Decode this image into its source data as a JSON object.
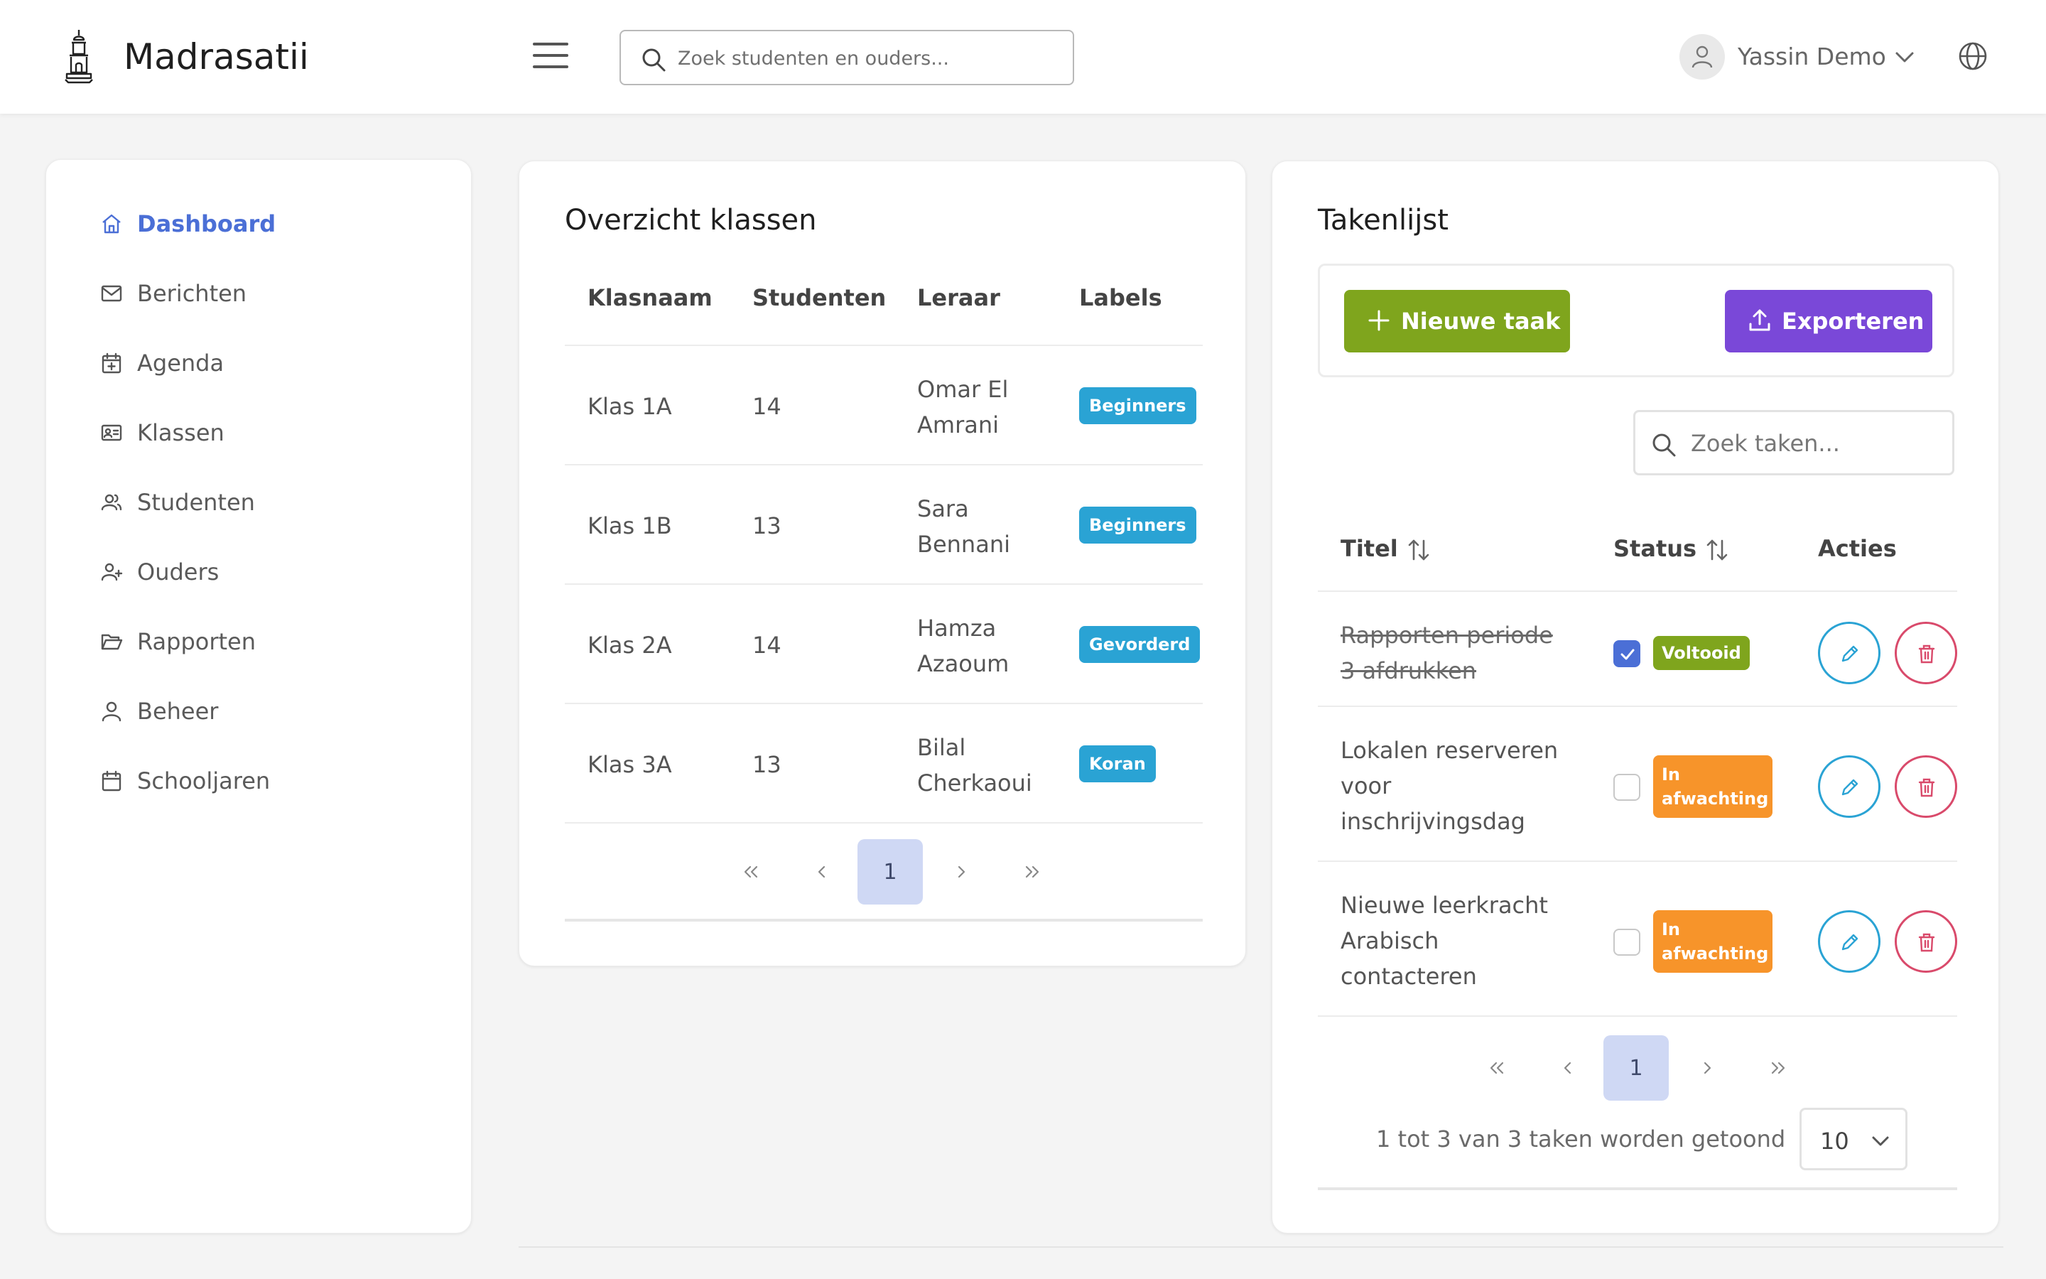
{
  "app": {
    "title": "Madrasatii"
  },
  "header": {
    "search_placeholder": "Zoek studenten en ouders...",
    "user_name": "Yassin Demo"
  },
  "sidebar": {
    "items": [
      {
        "label": "Dashboard",
        "icon": "home-icon",
        "active": true
      },
      {
        "label": "Berichten",
        "icon": "mail-icon"
      },
      {
        "label": "Agenda",
        "icon": "calendar-plus-icon"
      },
      {
        "label": "Klassen",
        "icon": "id-card-icon"
      },
      {
        "label": "Studenten",
        "icon": "users-icon"
      },
      {
        "label": "Ouders",
        "icon": "user-plus-icon"
      },
      {
        "label": "Rapporten",
        "icon": "folder-open-icon"
      },
      {
        "label": "Beheer",
        "icon": "user-icon"
      },
      {
        "label": "Schooljaren",
        "icon": "calendar-icon"
      }
    ]
  },
  "classes": {
    "title": "Overzicht klassen",
    "columns": [
      "Klasnaam",
      "Studenten",
      "Leraar",
      "Labels"
    ],
    "rows": [
      {
        "name": "Klas 1A",
        "students": "14",
        "teacher_line1": "Omar El",
        "teacher_line2": "Amrani",
        "label": "Beginners"
      },
      {
        "name": "Klas 1B",
        "students": "13",
        "teacher_line1": "Sara",
        "teacher_line2": "Bennani",
        "label": "Beginners"
      },
      {
        "name": "Klas 2A",
        "students": "14",
        "teacher_line1": "Hamza",
        "teacher_line2": "Azaoum",
        "label": "Gevorderd"
      },
      {
        "name": "Klas 3A",
        "students": "13",
        "teacher_line1": "Bilal",
        "teacher_line2": "Cherkaoui",
        "label": "Koran"
      }
    ],
    "current_page": "1"
  },
  "tasks": {
    "title": "Takenlijst",
    "new_label": "Nieuwe taak",
    "export_label": "Exporteren",
    "search_placeholder": "Zoek taken...",
    "columns": {
      "title": "Titel",
      "status": "Status",
      "actions": "Acties"
    },
    "rows": [
      {
        "title_lines": [
          "Rapporten periode",
          "3 afdrukken"
        ],
        "done": true,
        "status_lines": [
          "Voltooid"
        ]
      },
      {
        "title_lines": [
          "Lokalen reserveren",
          "voor",
          "inschrijvingsdag"
        ],
        "done": false,
        "status_lines": [
          "In",
          "afwachting"
        ]
      },
      {
        "title_lines": [
          "Nieuwe leerkracht",
          "Arabisch",
          "contacteren"
        ],
        "done": false,
        "status_lines": [
          "In",
          "afwachting"
        ]
      }
    ],
    "current_page": "1",
    "pager_info": "1 tot 3 van 3 taken worden getoond",
    "page_size": "10"
  },
  "colors": {
    "accent_blue": "#4b6fd6",
    "label_blue": "#2aa3d4",
    "green": "#7fa51d",
    "purple": "#7a48d8",
    "orange": "#f7942a",
    "danger": "#d94a6b"
  }
}
